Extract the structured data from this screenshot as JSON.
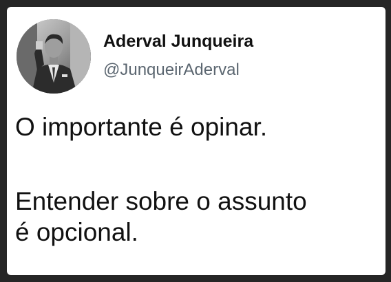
{
  "post": {
    "author_name": "Aderval Junqueira",
    "author_handle": "@JunqueirAderval",
    "text_line_1": "O importante é opinar.",
    "text_line_2": "Entender sobre o assunto",
    "text_line_3": "é opcional."
  },
  "avatar": {
    "icon": "profile-photo-man-in-suit"
  },
  "colors": {
    "card_background": "#ffffff",
    "outer_background": "#262626",
    "text_primary": "#111111",
    "text_secondary": "#5b6670"
  }
}
